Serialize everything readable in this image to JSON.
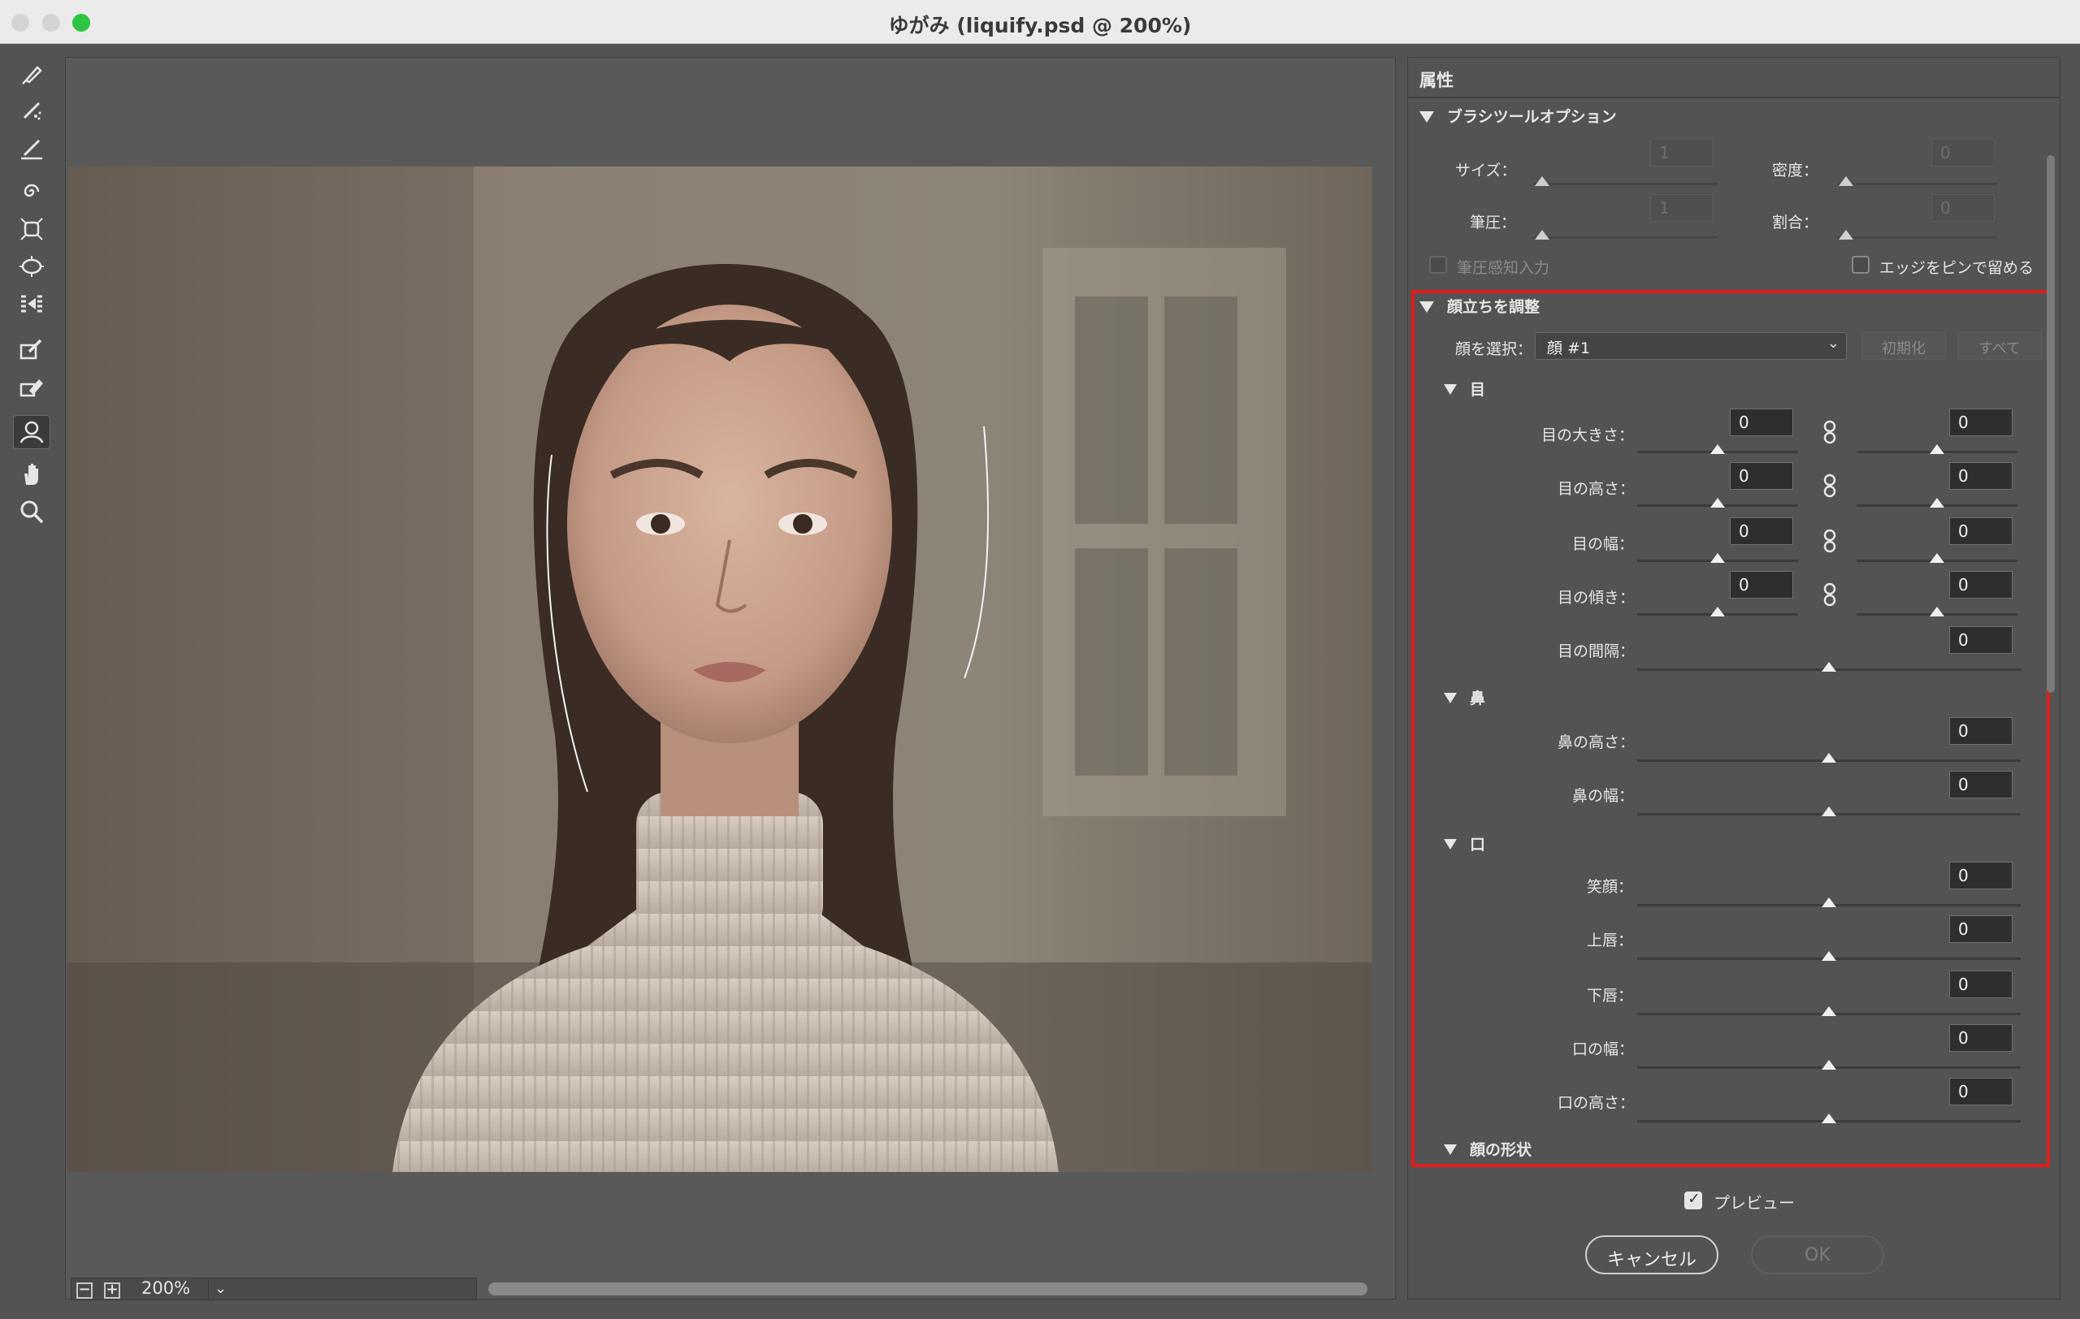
{
  "window": {
    "title": "ゆがみ (liquify.psd @ 200%)"
  },
  "toolbar": {
    "tools": [
      {
        "name": "forward-warp-tool"
      },
      {
        "name": "reconstruct-tool"
      },
      {
        "name": "smooth-tool"
      },
      {
        "name": "twirl-tool"
      },
      {
        "name": "pucker-tool"
      },
      {
        "name": "bloat-tool"
      },
      {
        "name": "push-left-tool"
      },
      {
        "name": "freeze-mask-tool"
      },
      {
        "name": "thaw-mask-tool"
      },
      {
        "name": "face-tool"
      },
      {
        "name": "hand-tool"
      },
      {
        "name": "zoom-tool"
      }
    ],
    "active_tool": "face-tool"
  },
  "canvas": {
    "zoom": "200%"
  },
  "panel": {
    "header": "属性",
    "brush": {
      "title": "ブラシツールオプション",
      "size_label": "サイズ：",
      "size_value": "1",
      "density_label": "密度：",
      "density_value": "0",
      "pressure_label": "筆圧：",
      "pressure_value": "1",
      "rate_label": "割合：",
      "rate_value": "0",
      "stylus_label": "筆圧感知入力",
      "pin_edges_label": "エッジをピンで留める"
    },
    "face": {
      "title": "顔立ちを調整",
      "select_label": "顔を選択：",
      "select_value": "顔 #1",
      "reset_label": "初期化",
      "all_label": "すべて",
      "eyes": {
        "title": "目",
        "rows": [
          {
            "label": "目の大きさ：",
            "left": "0",
            "right": "0"
          },
          {
            "label": "目の高さ：",
            "left": "0",
            "right": "0"
          },
          {
            "label": "目の幅：",
            "left": "0",
            "right": "0"
          },
          {
            "label": "目の傾き：",
            "left": "0",
            "right": "0"
          }
        ],
        "distance_label": "目の間隔：",
        "distance_value": "0"
      },
      "nose": {
        "title": "鼻",
        "rows": [
          {
            "label": "鼻の高さ：",
            "value": "0"
          },
          {
            "label": "鼻の幅：",
            "value": "0"
          }
        ]
      },
      "mouth": {
        "title": "口",
        "rows": [
          {
            "label": "笑顔：",
            "value": "0"
          },
          {
            "label": "上唇：",
            "value": "0"
          },
          {
            "label": "下唇：",
            "value": "0"
          },
          {
            "label": "口の幅：",
            "value": "0"
          },
          {
            "label": "口の高さ：",
            "value": "0"
          }
        ]
      },
      "shape": {
        "title": "顔の形状"
      }
    },
    "preview_label": "プレビュー",
    "preview_checked": true,
    "cancel_label": "キャンセル",
    "ok_label": "OK"
  },
  "colors": {
    "highlight": "#e21b1b",
    "panel_bg": "#535353",
    "maximize": "#2dc541"
  }
}
